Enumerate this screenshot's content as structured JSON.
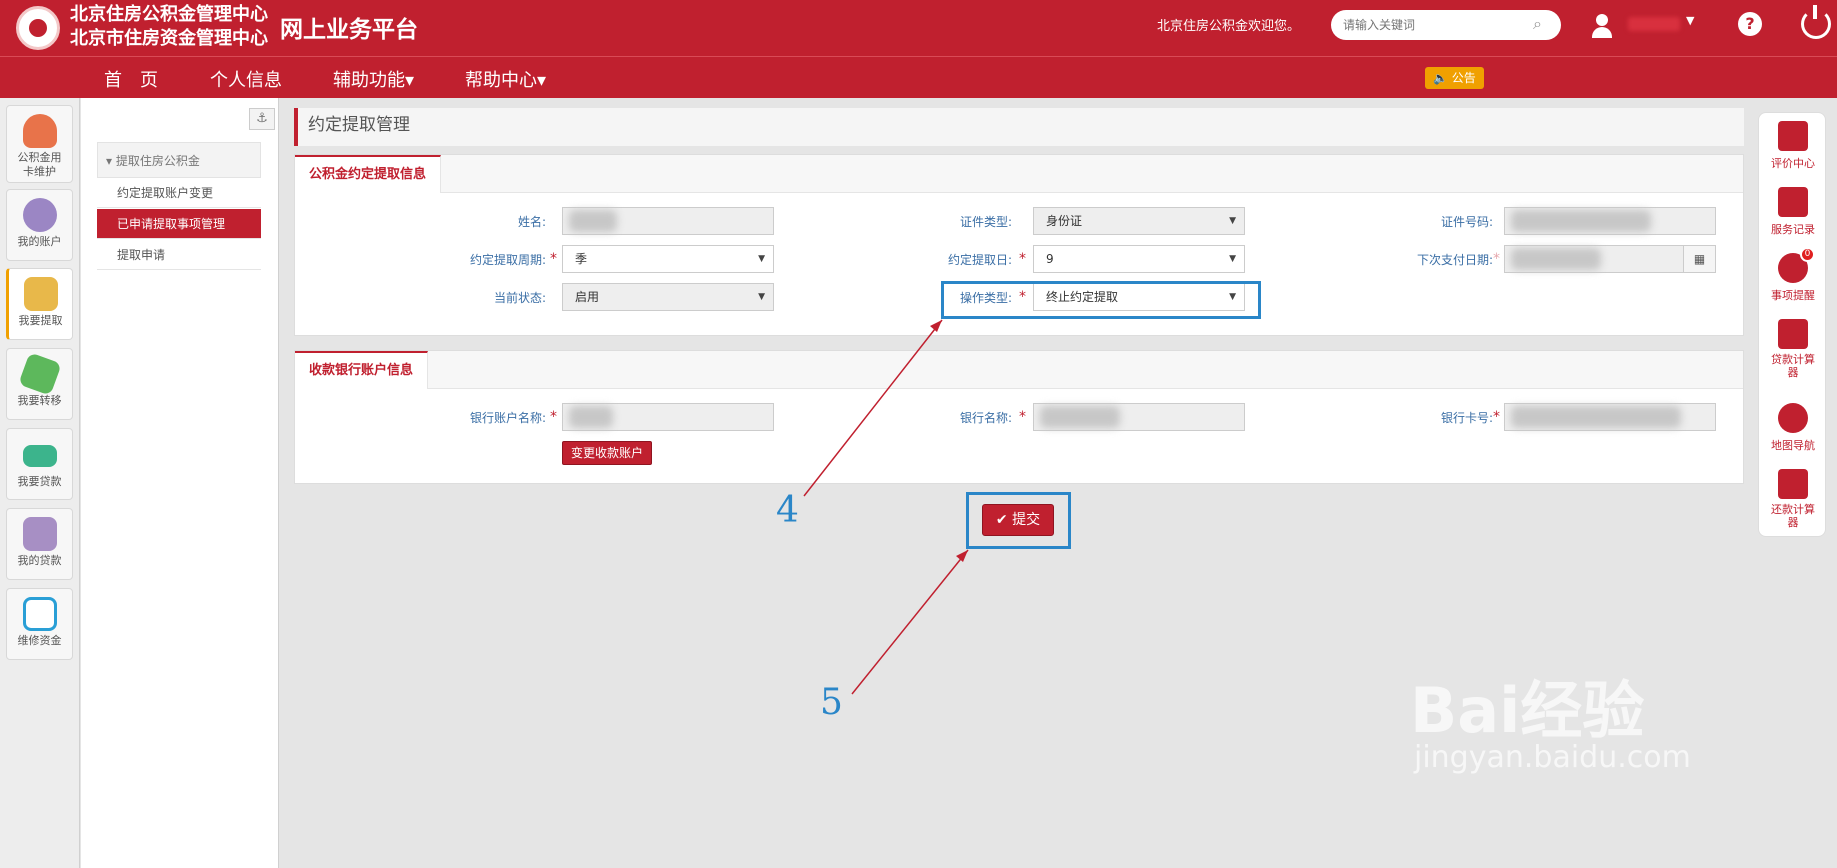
{
  "header": {
    "org_line1": "北京住房公积金管理中心",
    "org_line2": "北京市住房资金管理中心",
    "platform": "网上业务平台",
    "welcome": "北京住房公积金欢迎您。",
    "search_placeholder": "请输入关键词",
    "help_glyph": "?"
  },
  "nav": {
    "items": [
      "首　页",
      "个人信息",
      "辅助功能▾",
      "帮助中心▾"
    ],
    "notice": "🔈 公告"
  },
  "left_rail": [
    {
      "label": "公积金用卡维护",
      "icon": "person-card-icon"
    },
    {
      "label": "我的账户",
      "icon": "users-icon"
    },
    {
      "label": "我要提取",
      "icon": "coins-icon"
    },
    {
      "label": "我要转移",
      "icon": "transfer-tag-icon"
    },
    {
      "label": "我要贷款",
      "icon": "money-stack-icon"
    },
    {
      "label": "我的贷款",
      "icon": "loan-house-icon"
    },
    {
      "label": "维修资金",
      "icon": "edit-icon"
    }
  ],
  "submenu": {
    "anchor_glyph": "⚓",
    "group": "提取住房公积金",
    "links": [
      "约定提取账户变更",
      "已申请提取事项管理",
      "提取申请"
    ],
    "active_index": 1
  },
  "page": {
    "title": "约定提取管理",
    "section1_title": "公积金约定提取信息",
    "section2_title": "收款银行账户信息"
  },
  "form": {
    "name_label": "姓名:",
    "cert_type_label": "证件类型:",
    "cert_type_value": "身份证",
    "cert_no_label": "证件号码:",
    "period_label": "约定提取周期:",
    "period_value": "季",
    "day_label": "约定提取日:",
    "day_value": "9",
    "next_date_label": "下次支付日期:",
    "status_label": "当前状态:",
    "status_value": "启用",
    "op_type_label": "操作类型:",
    "op_type_value": "终止约定提取",
    "bank_acct_name_label": "银行账户名称:",
    "bank_name_label": "银行名称:",
    "bank_card_label": "银行卡号:",
    "change_account_btn": "变更收款账户",
    "submit_btn": "✔ 提交",
    "required_mark": "*",
    "calendar_glyph": "▦",
    "caret_glyph": "▼"
  },
  "annotations": {
    "num4": "4",
    "num5": "5"
  },
  "right_rail": [
    {
      "label": "评价中心",
      "icon": "rating-monitor-icon"
    },
    {
      "label": "服务记录",
      "icon": "record-list-icon"
    },
    {
      "label": "事项提醒",
      "icon": "alarm-clock-icon",
      "badge": "0"
    },
    {
      "label": "贷款计算器",
      "icon": "loan-calculator-icon"
    },
    {
      "label": "地图导航",
      "icon": "globe-icon"
    },
    {
      "label": "还款计算器",
      "icon": "repay-calculator-icon"
    }
  ],
  "watermark": {
    "big": "Bai经验",
    "small": "jingyan.baidu.com"
  },
  "colors": {
    "brand_red": "#c0202f",
    "annotation_blue": "#2a86c8",
    "notice_orange": "#f0a000"
  }
}
